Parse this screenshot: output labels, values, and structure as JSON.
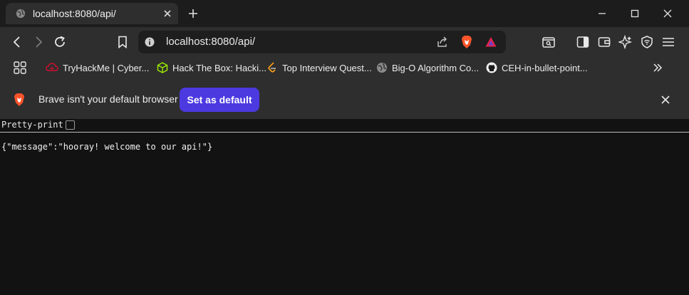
{
  "tab": {
    "title": "localhost:8080/api/"
  },
  "address_bar": {
    "url": "localhost:8080/api/"
  },
  "bookmarks": [
    {
      "label": "TryHackMe | Cyber...",
      "icon": "tryhackme-icon"
    },
    {
      "label": "Hack The Box: Hacki...",
      "icon": "hackthebox-icon"
    },
    {
      "label": "Top Interview Quest...",
      "icon": "leetcode-icon"
    },
    {
      "label": "Big-O Algorithm Co...",
      "icon": "globe-icon"
    },
    {
      "label": "CEH-in-bullet-point...",
      "icon": "github-icon"
    }
  ],
  "infobar": {
    "message": "Brave isn't your default browser",
    "button_label": "Set as default"
  },
  "viewer": {
    "pretty_print_label": "Pretty-print",
    "pretty_print_checked": false,
    "raw_json": "{\"message\":\"hooray! welcome to our api!\"}"
  },
  "colors": {
    "accent": "#4c3ae0",
    "brave_orange": "#fb542b",
    "page_background": "#121212",
    "toolbar": "#2e2e2e"
  }
}
